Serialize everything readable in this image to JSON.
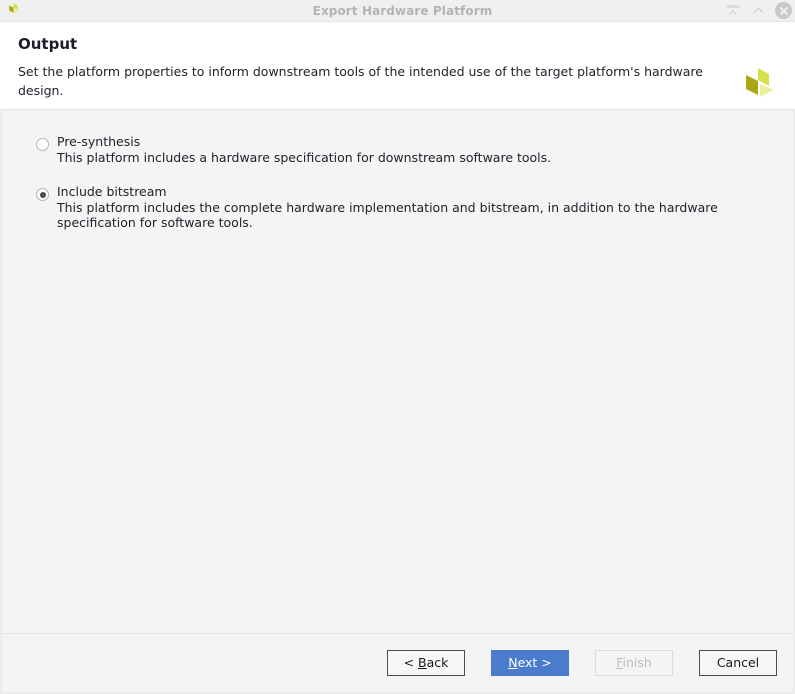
{
  "window": {
    "title": "Export Hardware Platform",
    "app_icon": "vitis-logo-icon",
    "controls": {
      "shade_label": "Shade",
      "collapse_label": "Collapse",
      "close_label": "Close"
    }
  },
  "header": {
    "title": "Output",
    "description": "Set the platform properties to inform downstream tools of the intended use of the target platform's hardware design.",
    "logo": "vitis-logo-icon"
  },
  "options": [
    {
      "label": "Pre-synthesis",
      "description": "This platform includes a hardware specification for downstream software tools.",
      "selected": false
    },
    {
      "label": "Include bitstream",
      "description": "This platform includes the complete hardware implementation and bitstream, in addition to the hardware specification for software tools.",
      "selected": true
    }
  ],
  "footer": {
    "back": {
      "prefix": "< ",
      "mnemonic": "B",
      "suffix": "ack"
    },
    "next": {
      "prefix": "",
      "mnemonic": "N",
      "suffix": "ext >"
    },
    "finish": {
      "prefix": "",
      "mnemonic": "F",
      "suffix": "inish"
    },
    "cancel": {
      "prefix": "",
      "mnemonic": "",
      "suffix": "Cancel"
    }
  },
  "colors": {
    "accent_blue": "#4a7bcd",
    "titlebar_bg": "#f0f0f0",
    "body_bg": "#f4f4f4",
    "header_bg": "#ffffff",
    "logo_light": "#d6e04a",
    "logo_mid": "#a8a814",
    "logo_pale": "#eaf09a"
  }
}
